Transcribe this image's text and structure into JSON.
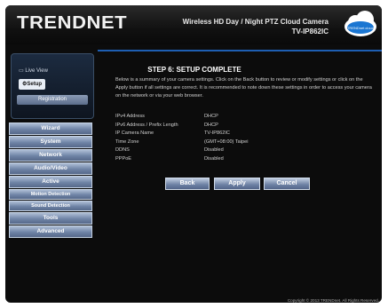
{
  "header": {
    "logo": "TRENDNET",
    "title_line1": "Wireless HD Day / Night PTZ Cloud Camera",
    "title_line2": "TV-IP862IC",
    "cloud_badge": "TRENDnet cloud"
  },
  "side_panel": {
    "live_view": "Live View",
    "setup": "Setup",
    "registration": "Registration"
  },
  "menu": [
    "Wizard",
    "System",
    "Network",
    "Audio/Video",
    "Active",
    "Motion Detection",
    "Sound Detection",
    "Tools",
    "Advanced"
  ],
  "content": {
    "step_title": "STEP 6: SETUP COMPLETE",
    "description": "Below is a summary of your camera settings. Click on the Back button to review or modify settings or click on the Apply button if all settings are correct. It is recommended to note down these settings in order to access your camera on the network or via your web browser.",
    "settings": [
      {
        "label": "IPv4 Address",
        "value": "DHCP"
      },
      {
        "label": "IPv6 Address / Prefix Length",
        "value": "DHCP"
      },
      {
        "label": "IP Camera Name",
        "value": "TV-IP862IC"
      },
      {
        "label": "Time Zone",
        "value": "(GMT+08:00) Taipei"
      },
      {
        "label": "DDNS",
        "value": "Disabled"
      },
      {
        "label": "PPPoE",
        "value": "Disabled"
      }
    ],
    "buttons": {
      "back": "Back",
      "apply": "Apply",
      "cancel": "Cancel"
    }
  },
  "footer": "Copyright © 2013 TRENDnet. All Rights Reserved."
}
